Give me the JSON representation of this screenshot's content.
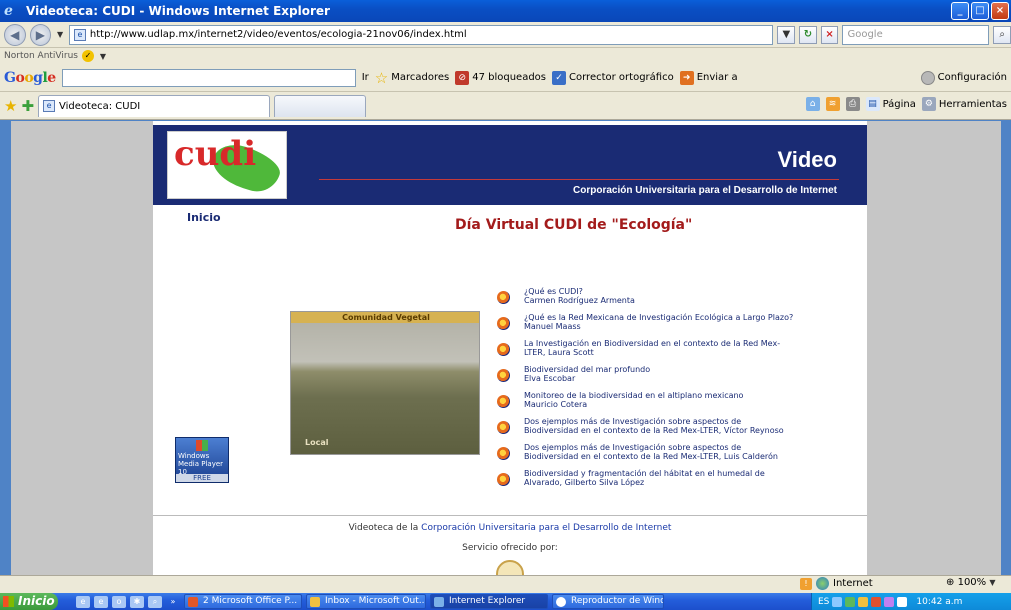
{
  "window": {
    "title": "Videoteca: CUDI - Windows Internet Explorer"
  },
  "address": {
    "url": "http://www.udlap.mx/internet2/video/eventos/ecologia-21nov06/index.html",
    "search_placeholder": "Google"
  },
  "norton": {
    "label": "Norton AntiVirus"
  },
  "google_toolbar": {
    "logo": "Google",
    "go_label": "Ir",
    "bookmarks_label": "Marcadores",
    "blocked_label": "47 bloqueados",
    "spellcheck_label": "Corrector ortográfico",
    "send_label": "Enviar a",
    "settings_label": "Configuración"
  },
  "tabs": {
    "active_label": "Videoteca: CUDI"
  },
  "tab_tools": {
    "page_label": "Página",
    "tools_label": "Herramientas"
  },
  "page": {
    "banner_title": "Video",
    "banner_subtitle": "Corporación Universitaria para el Desarrollo de Internet",
    "logo_text": "cudi",
    "nav_home": "Inicio",
    "heading": "Día Virtual CUDI de \"Ecología\"",
    "video_caption": "Comunidad Vegetal",
    "video_location": "Local",
    "wmp_badge": {
      "line1": "Windows",
      "line2": "Media Player 10",
      "line3": "FREE"
    },
    "lectures": [
      {
        "title": "¿Qué es CUDI?",
        "speaker": "Carmen Rodríguez Armenta"
      },
      {
        "title": "¿Qué es la Red Mexicana de Investigación Ecológica a Largo Plazo?",
        "speaker": "Manuel Maass"
      },
      {
        "title": "La Investigación en Biodiversidad en el contexto de la Red Mex-",
        "speaker": "LTER, Laura Scott"
      },
      {
        "title": "Biodiversidad del mar profundo",
        "speaker": "Elva Escobar"
      },
      {
        "title": "Monitoreo de la biodiversidad en el altiplano mexicano",
        "speaker": "Mauricio Cotera"
      },
      {
        "title": "Dos ejemplos más de Investigación sobre aspectos de",
        "speaker": "Biodiversidad en el contexto de la Red Mex-LTER, Víctor Reynoso"
      },
      {
        "title": "Dos ejemplos más de Investigación sobre aspectos de",
        "speaker": "Biodiversidad en el contexto de la Red Mex-LTER, Luis Calderón"
      },
      {
        "title": "Biodiversidad y fragmentación del hábitat en el humedal de",
        "speaker": "Alvarado, Gilberto Silva López"
      }
    ],
    "footer_prefix": "Videoteca de la",
    "footer_link": "Corporación Universitaria para el Desarrollo de Internet",
    "footer_service": "Servicio ofrecido por:"
  },
  "statusbar": {
    "zone": "Internet",
    "zoom": "100%"
  },
  "taskbar": {
    "start_label": "Inicio",
    "tasks": [
      "2 Microsoft Office P...",
      "Inbox - Microsoft Out...",
      "Internet Explorer",
      "Reproductor de Wind..."
    ],
    "language": "ES",
    "clock": "10:42 a.m"
  },
  "colors": {
    "banner": "#1a2b74",
    "heading": "#a31b1b",
    "link": "#1a2b74",
    "page_bg": "#c6c6c6"
  }
}
